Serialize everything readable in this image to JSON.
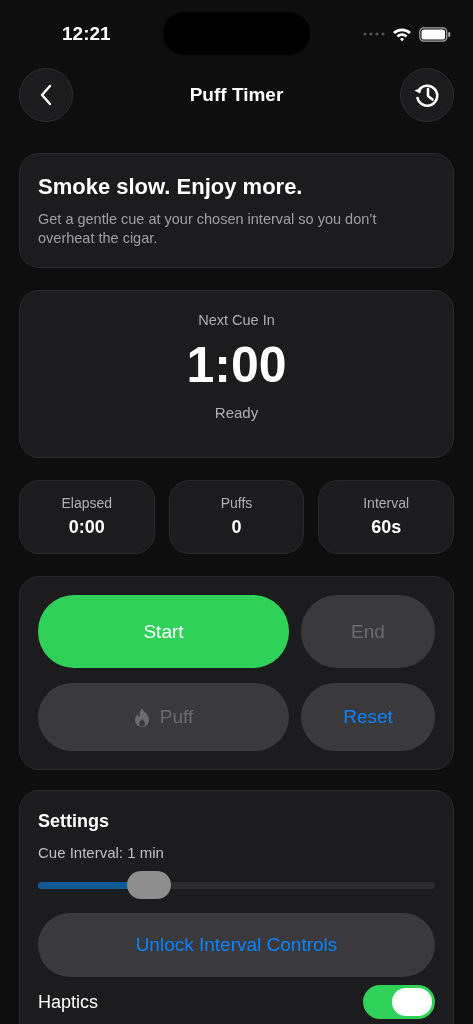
{
  "status_bar": {
    "time": "12:21"
  },
  "nav": {
    "title": "Puff Timer"
  },
  "intro": {
    "heading": "Smoke slow. Enjoy more.",
    "text": "Get a gentle cue at your chosen interval so you don’t overheat the cigar."
  },
  "countdown": {
    "label": "Next Cue In",
    "value": "1:00",
    "status": "Ready"
  },
  "stats": [
    {
      "label": "Elapsed",
      "value": "0:00"
    },
    {
      "label": "Puffs",
      "value": "0"
    },
    {
      "label": "Interval",
      "value": "60s"
    }
  ],
  "controls": [
    {
      "label": "Start",
      "kind": "primary",
      "disabled": false
    },
    {
      "label": "End",
      "kind": "secondary",
      "disabled": true
    },
    {
      "label": "Puff",
      "kind": "puff",
      "disabled": true
    },
    {
      "label": "Reset",
      "kind": "link",
      "disabled": false
    }
  ],
  "settings": {
    "title": "Settings",
    "interval_label": "Cue Interval: 1 min",
    "slider": {
      "level": 0.28
    },
    "unlock_button": "Unlock Interval Controls",
    "toggles": [
      {
        "label": "Haptics",
        "on": true
      }
    ]
  }
}
